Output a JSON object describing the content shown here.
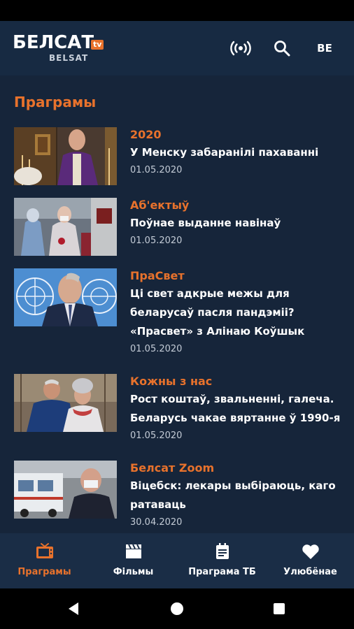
{
  "header": {
    "logo_main": "БЕЛСАТ",
    "logo_tv": "tv",
    "logo_sub": "BELSAT",
    "language": "BE"
  },
  "section_title": "Праграмы",
  "items": [
    {
      "category": "2020",
      "title": "У Менску забаранілі пахаванні",
      "date": "01.05.2020"
    },
    {
      "category": "Аб'ектыў",
      "title": "Поўнае выданне навінаў",
      "date": "01.05.2020"
    },
    {
      "category": "ПраСвет",
      "title": "Ці свет адкрые межы для беларусаў пасля пандэміі? «Прасвет» з Алінаю Коўшык",
      "date": "01.05.2020"
    },
    {
      "category": "Кожны з нас",
      "title": "Рост коштаў, звальненні, галеча. Беларусь чакае вяртанне ў 1990-я",
      "date": "01.05.2020"
    },
    {
      "category": "Белсат Zoom",
      "title": "Віцебск: лекары выбіраюць, каго ратаваць",
      "date": "30.04.2020"
    }
  ],
  "bottom_nav": [
    {
      "label": "Праграмы",
      "icon": "tv-icon",
      "active": true
    },
    {
      "label": "Фільмы",
      "icon": "film-clapper-icon",
      "active": false
    },
    {
      "label": "Праграма ТБ",
      "icon": "schedule-icon",
      "active": false
    },
    {
      "label": "Улюбёнае",
      "icon": "heart-icon",
      "active": false
    }
  ],
  "colors": {
    "accent": "#e8722c",
    "background": "#16253a",
    "appbar": "#172a42",
    "bottom_nav": "#1a2d46"
  }
}
